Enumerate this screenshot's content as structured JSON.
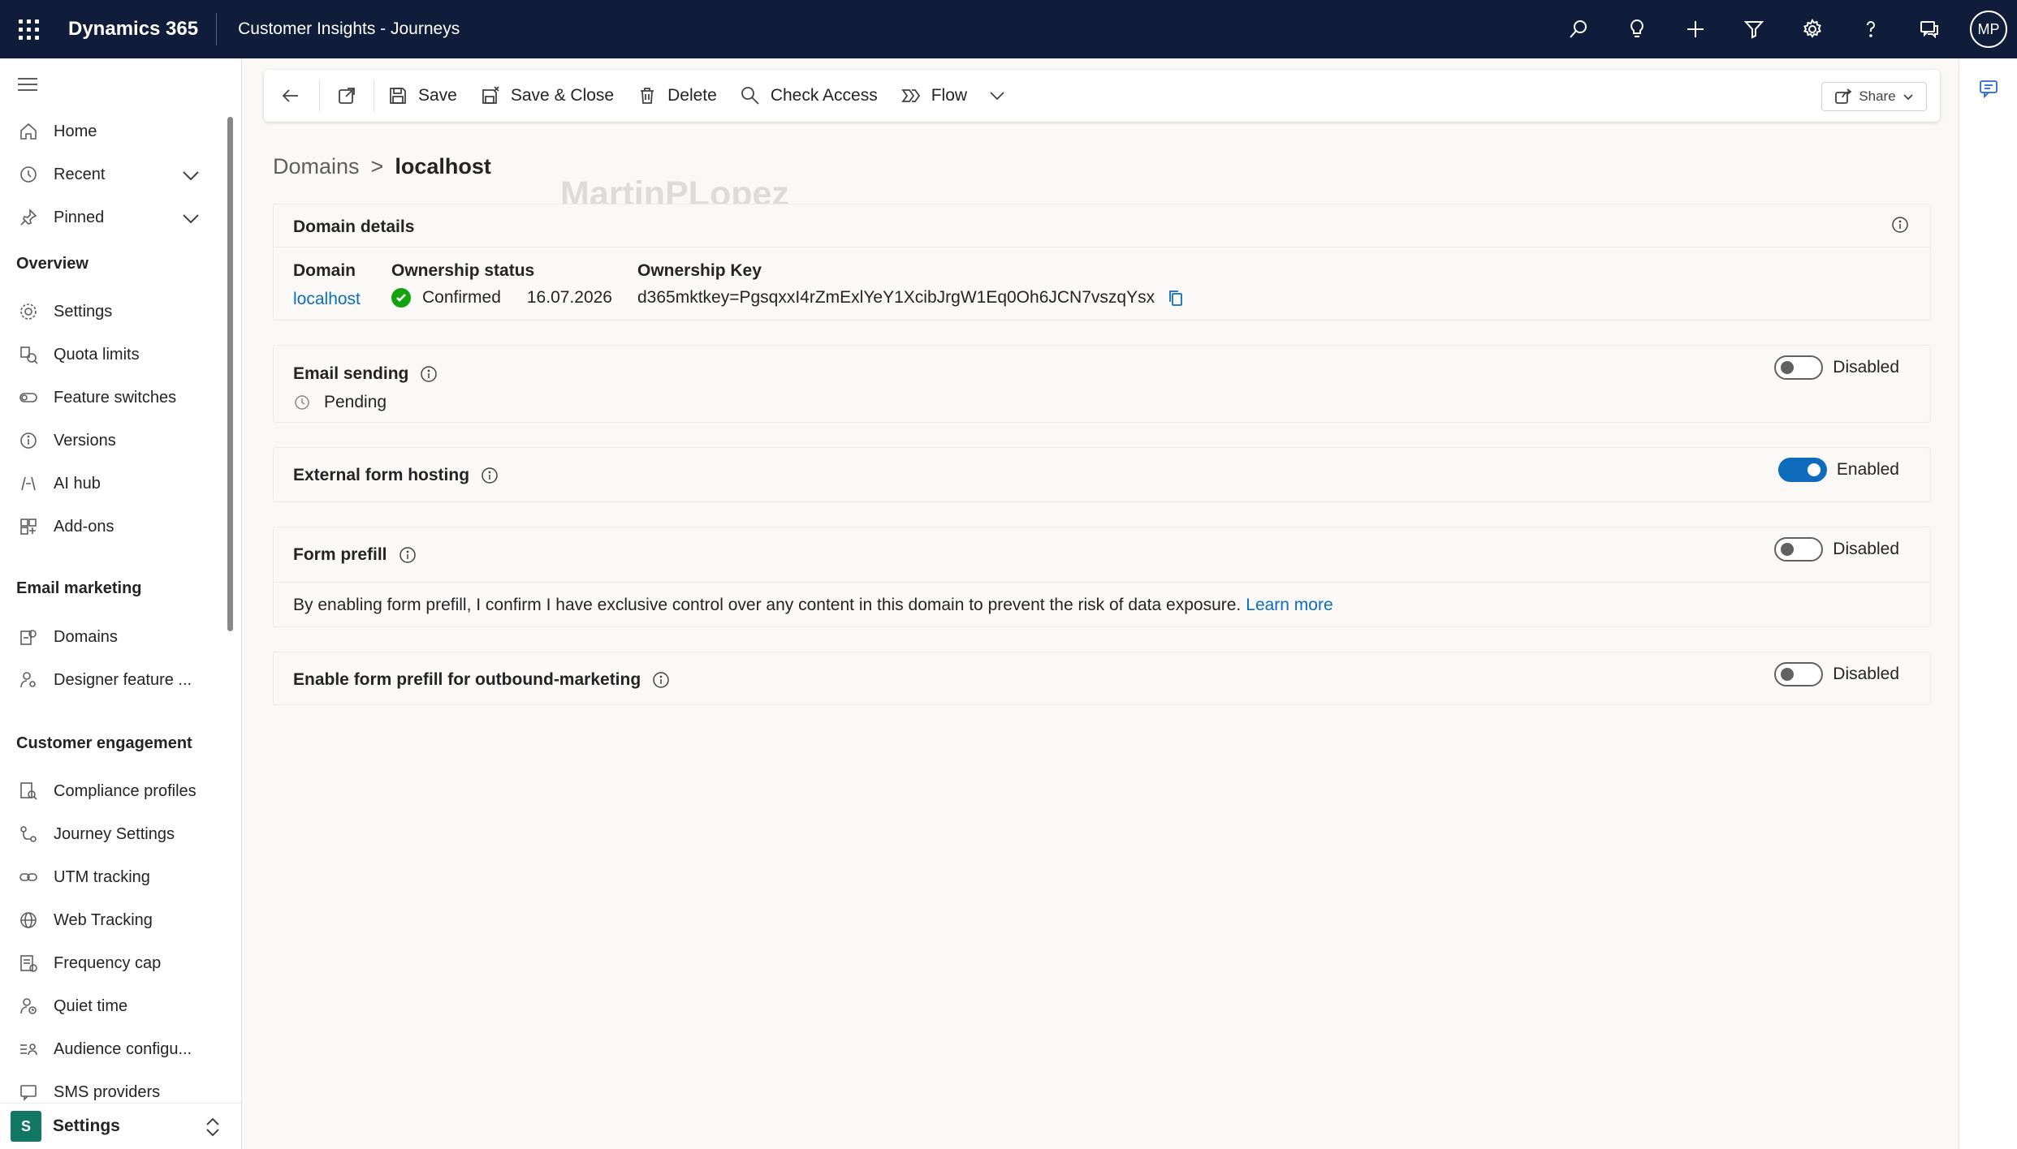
{
  "topbar": {
    "brand": "Dynamics 365",
    "app_name": "Customer Insights - Journeys",
    "avatar_initials": "MP",
    "icons": [
      "search-icon",
      "lightbulb-icon",
      "plus-icon",
      "filter-icon",
      "gear-icon",
      "help-icon",
      "chat-icon"
    ]
  },
  "sidenav": {
    "home": "Home",
    "recent": "Recent",
    "pinned": "Pinned",
    "groups": {
      "overview": "Overview",
      "email_marketing": "Email marketing",
      "customer_engagement": "Customer engagement"
    },
    "overview_items": [
      "Settings",
      "Quota limits",
      "Feature switches",
      "Versions",
      "AI hub",
      "Add-ons"
    ],
    "email_items": [
      "Domains",
      "Designer feature ..."
    ],
    "engagement_items": [
      "Compliance profiles",
      "Journey Settings",
      "UTM tracking",
      "Web Tracking",
      "Frequency cap",
      "Quiet time",
      "Audience configu...",
      "SMS providers"
    ],
    "area_badge": "S",
    "area_label": "Settings"
  },
  "cmdbar": {
    "save": "Save",
    "save_close": "Save & Close",
    "delete": "Delete",
    "check_access": "Check Access",
    "flow": "Flow",
    "share": "Share"
  },
  "breadcrumb": {
    "parent": "Domains",
    "separator": ">",
    "current": "localhost"
  },
  "watermark": "MartinPLopez",
  "domain_details": {
    "title": "Domain details",
    "domain_label": "Domain",
    "domain_value": "localhost",
    "ownership_status_label": "Ownership status",
    "ownership_status_value": "Confirmed",
    "ownership_date": "16.07.2026",
    "ownership_key_label": "Ownership Key",
    "ownership_key_value": "d365mktkey=PgsqxxI4rZmExlYeY1XcibJrgW1Eq0Oh6JCN7vszqYsx"
  },
  "email_sending": {
    "title": "Email sending",
    "status": "Pending",
    "toggle_label": "Disabled",
    "enabled": false
  },
  "external_form_hosting": {
    "title": "External form hosting",
    "toggle_label": "Enabled",
    "enabled": true
  },
  "form_prefill": {
    "title": "Form prefill",
    "toggle_label": "Disabled",
    "enabled": false,
    "description": "By enabling form prefill, I confirm I have exclusive control over any content in this domain to prevent the risk of data exposure.",
    "learn_more": "Learn more"
  },
  "outbound_prefill": {
    "title": "Enable form prefill for outbound-marketing",
    "toggle_label": "Disabled",
    "enabled": false
  },
  "colors": {
    "topbar": "#0f1d3b",
    "accent": "#0f6cbd",
    "success": "#13a10e",
    "area_badge": "#117865"
  }
}
